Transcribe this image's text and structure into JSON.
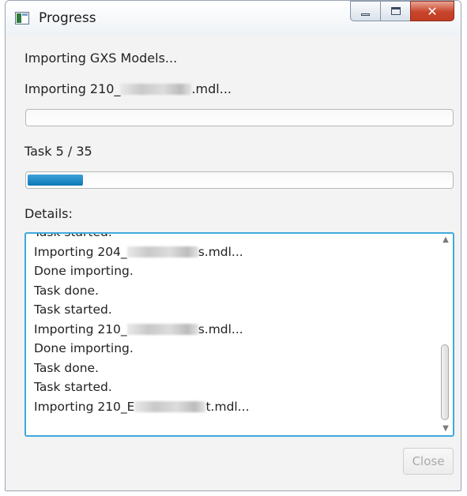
{
  "window": {
    "title": "Progress",
    "icon": "app-icon",
    "caption_buttons": {
      "minimize": "minimize",
      "maximize": "maximize",
      "close": "✕"
    }
  },
  "main": {
    "heading": "Importing GXS Models...",
    "current_file": {
      "prefix": "Importing 210_",
      "suffix": ".mdl..."
    },
    "file_progress": 0,
    "task_label": "Task 5 / 35",
    "task_progress": 0.13,
    "details_label": "Details:"
  },
  "details": {
    "log": [
      {
        "before": "Task started.",
        "after": "",
        "redacted": false
      },
      {
        "before": "Importing 204_",
        "after": "s.mdl...",
        "redacted": true
      },
      {
        "before": "Done importing.",
        "after": "",
        "redacted": false
      },
      {
        "before": "Task done.",
        "after": "",
        "redacted": false
      },
      {
        "before": "Task started.",
        "after": "",
        "redacted": false
      },
      {
        "before": "Importing 210_",
        "after": "s.mdl...",
        "redacted": true
      },
      {
        "before": "Done importing.",
        "after": "",
        "redacted": false
      },
      {
        "before": "Task done.",
        "after": "",
        "redacted": false
      },
      {
        "before": "Task started.",
        "after": "",
        "redacted": false
      },
      {
        "before": "Importing 210_E",
        "after": "t.mdl...",
        "redacted": true
      }
    ]
  },
  "footer": {
    "close_label": "Close",
    "close_enabled": false
  },
  "colors": {
    "accent": "#0b79b8",
    "focus_border": "#3fa9dd",
    "close_caption": "#c7442b"
  }
}
